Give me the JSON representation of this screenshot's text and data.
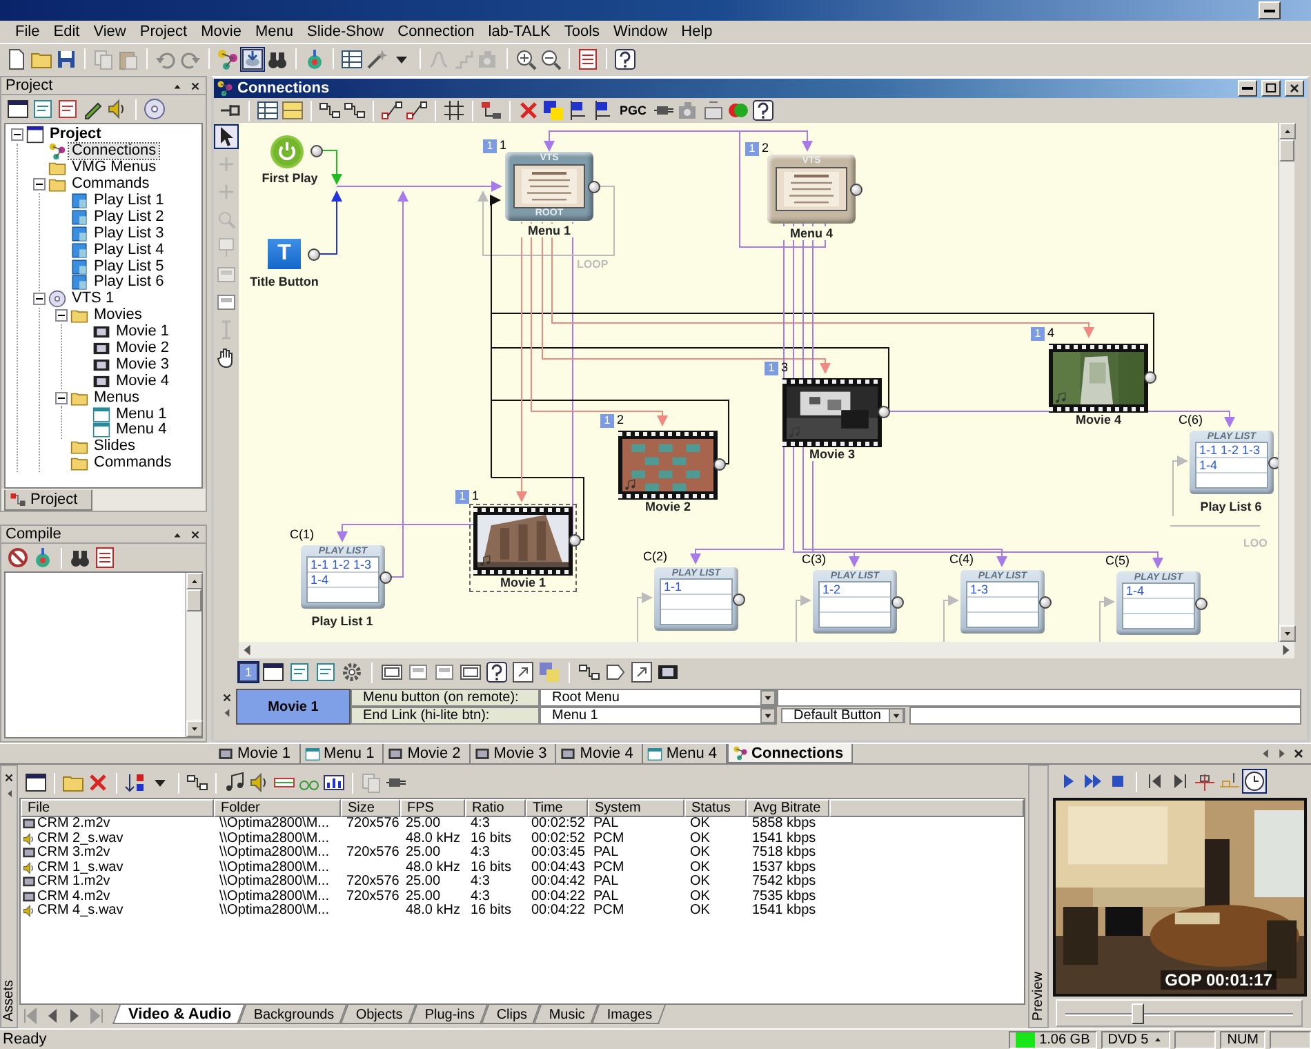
{
  "menubar": [
    "File",
    "Edit",
    "View",
    "Project",
    "Movie",
    "Menu",
    "Slide-Show",
    "Connection",
    "lab-TALK",
    "Tools",
    "Window",
    "Help"
  ],
  "project_panel": {
    "title": "Project",
    "tab": "Project",
    "tree": [
      {
        "label": "Project",
        "kind": "project",
        "expanded": true,
        "selected": false,
        "children": [
          {
            "label": "Connections",
            "kind": "link",
            "selected": true
          },
          {
            "label": "VMG Menus",
            "kind": "folder",
            "selected": false
          },
          {
            "label": "Commands",
            "kind": "folder",
            "expanded": true,
            "selected": false,
            "children": [
              {
                "label": "Play List 1",
                "kind": "playlist",
                "selected": false
              },
              {
                "label": "Play List 2",
                "kind": "playlist",
                "selected": false
              },
              {
                "label": "Play List 3",
                "kind": "playlist",
                "selected": false
              },
              {
                "label": "Play List 4",
                "kind": "playlist",
                "selected": false
              },
              {
                "label": "Play List 5",
                "kind": "playlist",
                "selected": false
              },
              {
                "label": "Play List 6",
                "kind": "playlist",
                "selected": false
              }
            ]
          },
          {
            "label": "VTS 1",
            "kind": "disc",
            "expanded": true,
            "selected": false,
            "children": [
              {
                "label": "Movies",
                "kind": "folder",
                "expanded": true,
                "selected": false,
                "children": [
                  {
                    "label": "Movie 1",
                    "kind": "movie",
                    "selected": false
                  },
                  {
                    "label": "Movie 2",
                    "kind": "movie",
                    "selected": false
                  },
                  {
                    "label": "Movie 3",
                    "kind": "movie",
                    "selected": false
                  },
                  {
                    "label": "Movie 4",
                    "kind": "movie",
                    "selected": false
                  }
                ]
              },
              {
                "label": "Menus",
                "kind": "folder",
                "expanded": true,
                "selected": false,
                "children": [
                  {
                    "label": "Menu 1",
                    "kind": "menu",
                    "selected": false
                  },
                  {
                    "label": "Menu 4",
                    "kind": "menu",
                    "selected": false
                  }
                ]
              },
              {
                "label": "Slides",
                "kind": "folder",
                "selected": false
              },
              {
                "label": "Commands",
                "kind": "folder",
                "selected": false
              }
            ]
          }
        ]
      }
    ]
  },
  "compile_panel": {
    "title": "Compile"
  },
  "connections_window": {
    "title": "Connections",
    "toolbar_label": "PGC",
    "start_nodes": [
      {
        "kind": "first-play",
        "label": "First Play"
      },
      {
        "kind": "title-button",
        "glyph": "T",
        "label": "Title Button"
      }
    ],
    "menus": [
      {
        "badge": "1",
        "number": "1",
        "top_text": "VTS",
        "bottom_text": "ROOT",
        "label": "Menu 1",
        "color": "#7f9aa8"
      },
      {
        "badge": "1",
        "number": "2",
        "top_text": "VTS",
        "label": "Menu 4",
        "color": "#c4b8a2"
      }
    ],
    "movies": [
      {
        "badge": "1",
        "number": "4",
        "label": "Movie 4",
        "selected": false
      },
      {
        "badge": "1",
        "number": "3",
        "label": "Movie 3",
        "selected": false
      },
      {
        "badge": "1",
        "number": "2",
        "label": "Movie 2",
        "selected": false
      },
      {
        "badge": "1",
        "number": "1",
        "label": "Movie 1",
        "selected": true
      }
    ],
    "playlists": [
      {
        "caption": "C(1)",
        "header": "PLAY LIST",
        "lines": [
          "1-1 1-2 1-3",
          "1-4"
        ],
        "label": "Play List 1"
      },
      {
        "caption": "C(2)",
        "header": "PLAY LIST",
        "lines": [
          "1-1"
        ]
      },
      {
        "caption": "C(3)",
        "header": "PLAY LIST",
        "lines": [
          "1-2"
        ]
      },
      {
        "caption": "C(4)",
        "header": "PLAY LIST",
        "lines": [
          "1-3"
        ]
      },
      {
        "caption": "C(5)",
        "header": "PLAY LIST",
        "lines": [
          "1-4"
        ]
      },
      {
        "caption": "C(6)",
        "header": "PLAY LIST",
        "lines": [
          "1-1 1-2 1-3",
          "1-4"
        ],
        "label": "Play List 6"
      }
    ],
    "loop_labels": [
      "LOOP",
      "LOO"
    ],
    "view_toolbar_label": "1",
    "properties": {
      "object": "Movie 1",
      "rows": [
        {
          "label": "Menu button (on remote):",
          "value": "Root Menu"
        },
        {
          "label": "End Link (hi-lite btn):",
          "value": "Menu 1",
          "extra": "Default Button"
        }
      ]
    }
  },
  "document_tabs": [
    {
      "label": "Movie 1",
      "kind": "movie",
      "selected": false
    },
    {
      "label": "Menu 1",
      "kind": "menu",
      "selected": false
    },
    {
      "label": "Movie 2",
      "kind": "movie",
      "selected": false
    },
    {
      "label": "Movie 3",
      "kind": "movie",
      "selected": false
    },
    {
      "label": "Movie 4",
      "kind": "movie",
      "selected": false
    },
    {
      "label": "Menu 4",
      "kind": "menu",
      "selected": false
    },
    {
      "label": "Connections",
      "kind": "link",
      "selected": true
    }
  ],
  "assets": {
    "title": "Assets",
    "columns": [
      "File",
      "Folder",
      "Size",
      "FPS",
      "Ratio",
      "Time",
      "System",
      "Status",
      "Avg Bitrate"
    ],
    "rows": [
      {
        "kind": "video",
        "file": "CRM 2.m2v",
        "folder": "\\\\Optima2800\\M...",
        "size": "720x576",
        "fps": "25.00",
        "ratio": "4:3",
        "time": "00:02:52",
        "system": "PAL",
        "status": "OK",
        "avg_bitrate": "5858 kbps"
      },
      {
        "kind": "audio",
        "file": "CRM 2_s.wav",
        "folder": "\\\\Optima2800\\M...",
        "fps": "48.0 kHz",
        "ratio": "16 bits",
        "time": "00:02:52",
        "system": "PCM",
        "status": "OK",
        "avg_bitrate": "1541 kbps"
      },
      {
        "kind": "video",
        "file": "CRM 3.m2v",
        "folder": "\\\\Optima2800\\M...",
        "size": "720x576",
        "fps": "25.00",
        "ratio": "4:3",
        "time": "00:03:45",
        "system": "PAL",
        "status": "OK",
        "avg_bitrate": "7518 kbps"
      },
      {
        "kind": "audio",
        "file": "CRM 1_s.wav",
        "folder": "\\\\Optima2800\\M...",
        "fps": "48.0 kHz",
        "ratio": "16 bits",
        "time": "00:04:43",
        "system": "PCM",
        "status": "OK",
        "avg_bitrate": "1537 kbps"
      },
      {
        "kind": "video",
        "file": "CRM 1.m2v",
        "folder": "\\\\Optima2800\\M...",
        "size": "720x576",
        "fps": "25.00",
        "ratio": "4:3",
        "time": "00:04:42",
        "system": "PAL",
        "status": "OK",
        "avg_bitrate": "7542 kbps"
      },
      {
        "kind": "video",
        "file": "CRM 4.m2v",
        "folder": "\\\\Optima2800\\M...",
        "size": "720x576",
        "fps": "25.00",
        "ratio": "4:3",
        "time": "00:04:22",
        "system": "PAL",
        "status": "OK",
        "avg_bitrate": "7535 kbps"
      },
      {
        "kind": "audio",
        "file": "CRM 4_s.wav",
        "folder": "\\\\Optima2800\\M...",
        "fps": "48.0 kHz",
        "ratio": "16 bits",
        "time": "00:04:22",
        "system": "PCM",
        "status": "OK",
        "avg_bitrate": "1541 kbps"
      }
    ],
    "tabs": [
      {
        "label": "Video & Audio",
        "selected": true
      },
      {
        "label": "Backgrounds",
        "selected": false
      },
      {
        "label": "Objects",
        "selected": false
      },
      {
        "label": "Plug-ins",
        "selected": false
      },
      {
        "label": "Clips",
        "selected": false
      },
      {
        "label": "Music",
        "selected": false
      },
      {
        "label": "Images",
        "selected": false
      }
    ]
  },
  "preview": {
    "title": "Preview",
    "overlay": "GOP 00:01:17",
    "slider": {
      "level": 0.28
    }
  },
  "status_bar": {
    "message": "Ready",
    "disk": "1.06 GB",
    "media": "DVD 5",
    "keys": "NUM"
  }
}
